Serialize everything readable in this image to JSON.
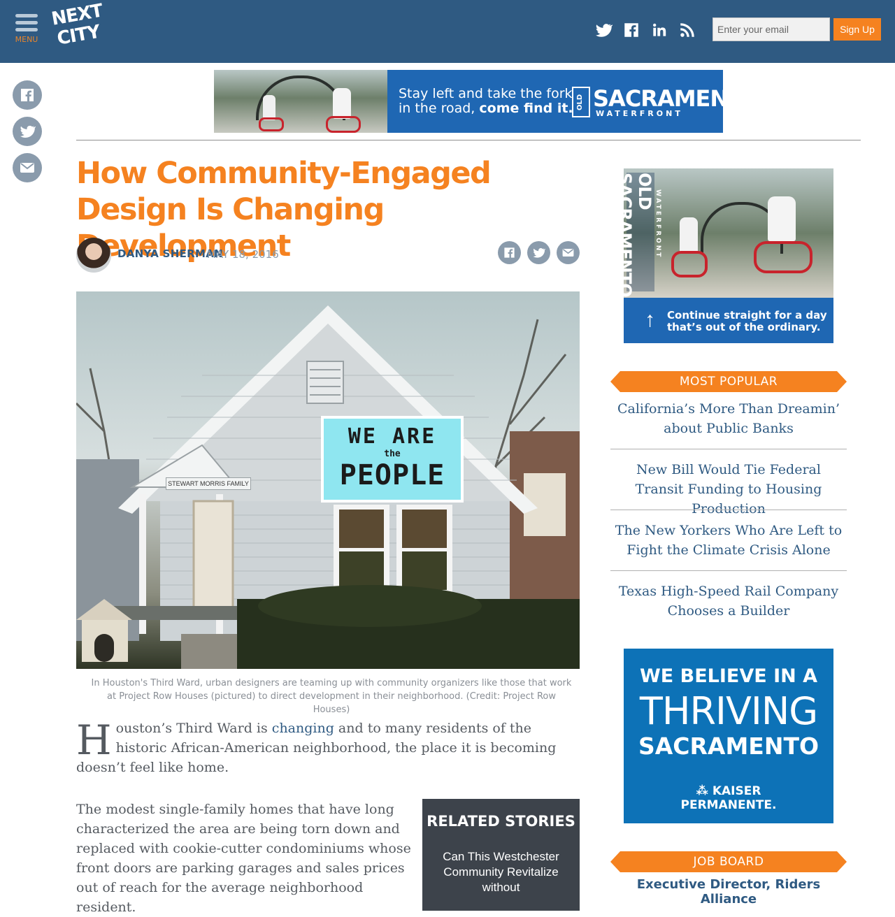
{
  "header": {
    "menu_label": "MENU",
    "logo_line1": "NEXT",
    "logo_line2": "CITY",
    "social": [
      "twitter-icon",
      "facebook-icon",
      "linkedin-icon",
      "rss-icon"
    ],
    "email_placeholder": "Enter your email",
    "signup_label": "Sign Up",
    "bg_color": "#2f5a82",
    "accent_color": "#f58220"
  },
  "share_rail": [
    "facebook-icon",
    "twitter-icon",
    "email-icon"
  ],
  "top_ad": {
    "line1": "Stay left and take the fork",
    "line2_plain": "in the road, ",
    "line2_bold": "come find it.",
    "brand_old": "OLD",
    "brand_city": "SACRAMENTO",
    "brand_sub": "WATERFRONT"
  },
  "article": {
    "title": "How Community-Engaged Design Is Changing Development",
    "author": "DANYA SHERMAN",
    "date": "MAY 18, 2016",
    "share": [
      "facebook-icon",
      "twitter-icon",
      "email-icon"
    ],
    "hero_sign_line1": "WE ARE",
    "hero_sign_small": "the",
    "hero_sign_line2": "PEOPLE",
    "hero_porch_sign": "STEWART MORRIS FAMILY",
    "caption": "In Houston's Third Ward, urban designers are teaming up with community organizers like those that work at Project Row Houses (pictured) to direct development in their neighborhood. (Credit: Project Row Houses)",
    "lede_dropcap": "H",
    "lede_before_link": "ouston’s Third Ward is ",
    "lede_link": "changing",
    "lede_after_link": " and to many residents of the historic African-American neighborhood, the place it is becoming doesn’t feel like home.",
    "para2": "The modest single-family homes that have long characterized the area are being torn down and replaced with cookie-cutter condominiums whose front doors are parking garages and sales prices out of reach for the average neighborhood resident."
  },
  "related": {
    "title": "RELATED STORIES",
    "first_link": "Can This Westchester Community Revitalize without"
  },
  "sidebar": {
    "ad1_brand_old": "OLD",
    "ad1_brand_city": "SACRAMENTO",
    "ad1_brand_sub": "WATERFRONT",
    "ad1_cta_line1": "Continue straight for a day",
    "ad1_cta_line2": "that’s out of the ordinary.",
    "most_popular_label": "MOST POPULAR",
    "most_popular": [
      "California’s More Than Dreamin’ about Public Banks",
      "New Bill Would Tie Federal Transit Funding to Housing Production",
      "The New Yorkers Who Are Left to Fight the Climate Crisis Alone",
      "Texas High-Speed Rail Company Chooses a Builder"
    ],
    "ad2_line1": "WE BELIEVE IN A",
    "ad2_line2": "THRIVING",
    "ad2_line3": "SACRAMENTO",
    "ad2_logo": "KAISER PERMANENTE.",
    "job_board_label": "JOB BOARD",
    "job_link": "Executive Director, Riders Alliance"
  }
}
